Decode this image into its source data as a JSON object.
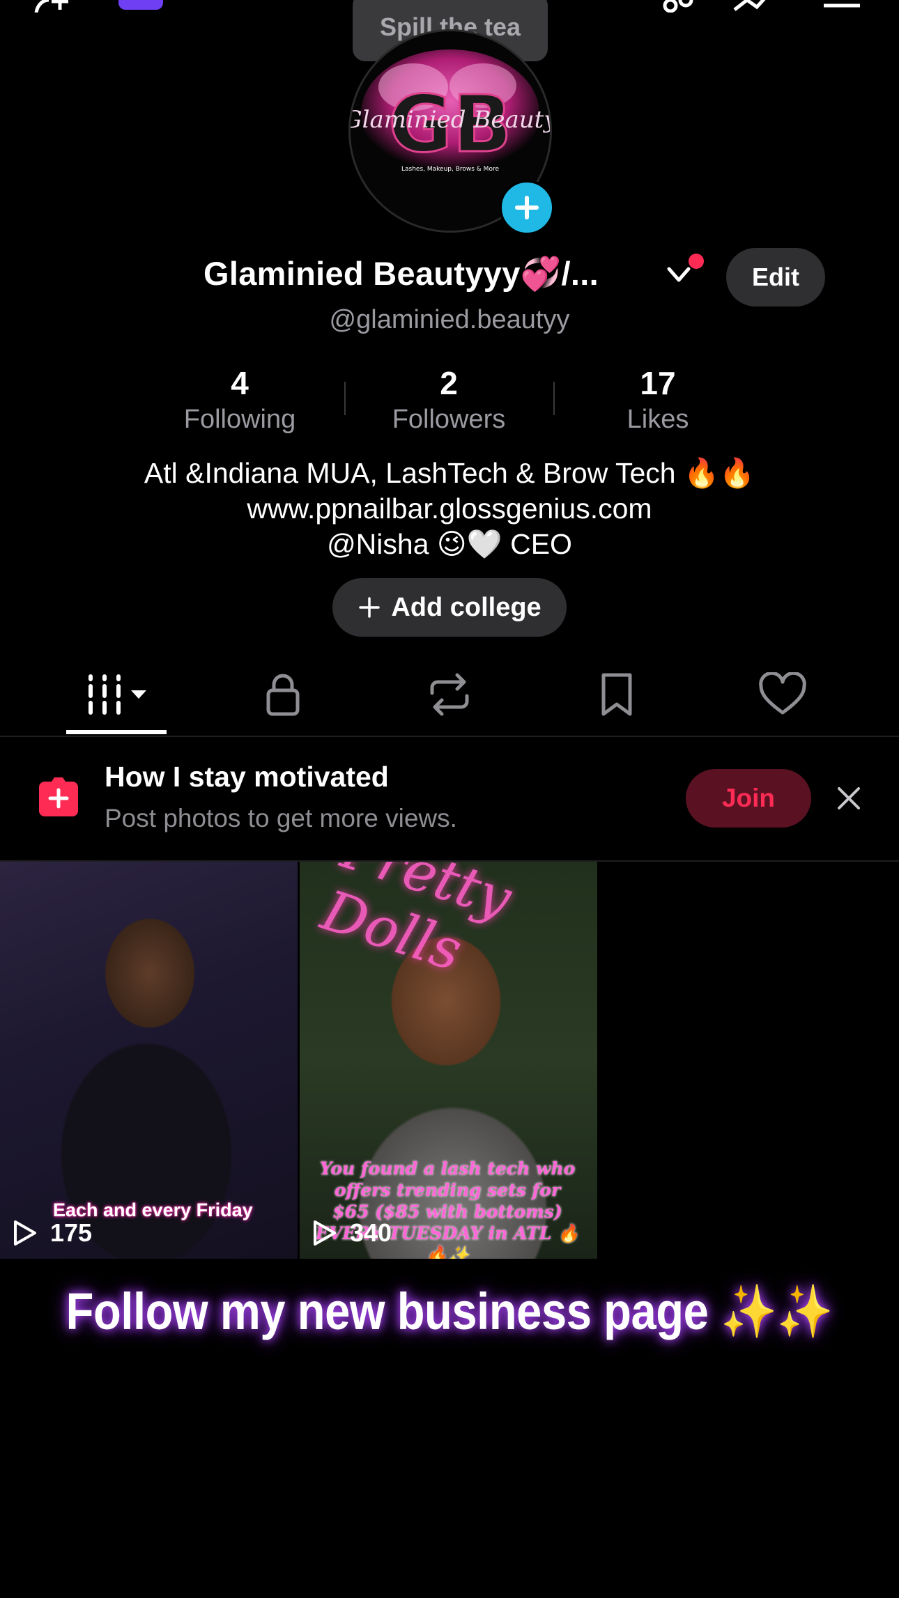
{
  "tooltip": "Spill the tea",
  "avatar": {
    "logo_letters": "GB",
    "logo_script": "Glaminied Beauty",
    "logo_tagline": "Lashes, Makeup, Brows & More"
  },
  "profile": {
    "name": "Glaminied Beautyyy💞/...",
    "edit_label": "Edit",
    "handle": "@glaminied.beautyy"
  },
  "stats": [
    {
      "value": "4",
      "label": "Following"
    },
    {
      "value": "2",
      "label": "Followers"
    },
    {
      "value": "17",
      "label": "Likes"
    }
  ],
  "bio": [
    "Atl &Indiana MUA, LashTech & Brow Tech 🔥🔥",
    "www.ppnailbar.glossgenius.com",
    "@Nisha 😉🤍 CEO"
  ],
  "college_button": "Add college",
  "tabs": [
    {
      "icon": "grid-icon",
      "active": true
    },
    {
      "icon": "lock-icon"
    },
    {
      "icon": "repost-icon"
    },
    {
      "icon": "bookmark-icon"
    },
    {
      "icon": "heart-icon"
    }
  ],
  "banner": {
    "title": "How I stay motivated",
    "subtitle": "Post photos to get more views.",
    "join_label": "Join"
  },
  "videos": [
    {
      "views": "175",
      "caption": "Each and every Friday"
    },
    {
      "views": "340",
      "caption": "You found a lash tech who offers trending sets for $65 ($85 with bottoms) EVERY TUESDAY in ATL 🔥🔥✨",
      "neon_sign": "Pretty Dolls"
    }
  ],
  "promo_text": "Follow my new business page ✨✨",
  "colors": {
    "background": "#000000",
    "accent_red": "#fe2c55",
    "avatar_add": "#20b9e6",
    "button_bg": "#2f2f31",
    "muted_text": "#9b9ba1"
  }
}
